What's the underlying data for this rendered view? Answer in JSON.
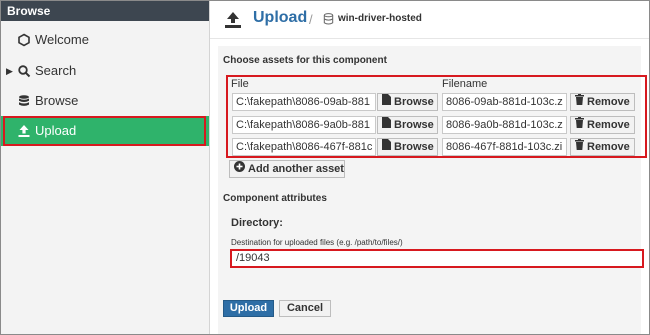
{
  "sidebar": {
    "header": "Browse",
    "items": [
      {
        "label": "Welcome",
        "icon": "hexagon-icon"
      },
      {
        "label": "Search",
        "icon": "search-icon"
      },
      {
        "label": "Browse",
        "icon": "database-icon"
      },
      {
        "label": "Upload",
        "icon": "upload-icon",
        "active": true
      }
    ]
  },
  "header": {
    "title": "Upload",
    "separator": "/",
    "repository": "win-driver-hosted"
  },
  "assets": {
    "section_title": "Choose assets for this component",
    "file_column": "File",
    "filename_column": "Filename",
    "browse_label": "Browse",
    "remove_label": "Remove",
    "rows": [
      {
        "path": "C:\\fakepath\\8086-09ab-881",
        "filename": "8086-09ab-881d-103c.z"
      },
      {
        "path": "C:\\fakepath\\8086-9a0b-881",
        "filename": "8086-9a0b-881d-103c.z"
      },
      {
        "path": "C:\\fakepath\\8086-467f-881c",
        "filename": "8086-467f-881d-103c.zi"
      }
    ],
    "add_label": "Add another asset"
  },
  "attributes": {
    "section_title": "Component attributes",
    "directory_label": "Directory:",
    "directory_hint": "Destination for uploaded files (e.g. /path/to/files/)",
    "directory_value": "/19043"
  },
  "actions": {
    "upload_label": "Upload",
    "cancel_label": "Cancel"
  },
  "colors": {
    "accent": "#2e6ea6",
    "active_nav": "#2fb36b",
    "highlight": "#d7191f",
    "sidebar_header": "#3d4650"
  }
}
